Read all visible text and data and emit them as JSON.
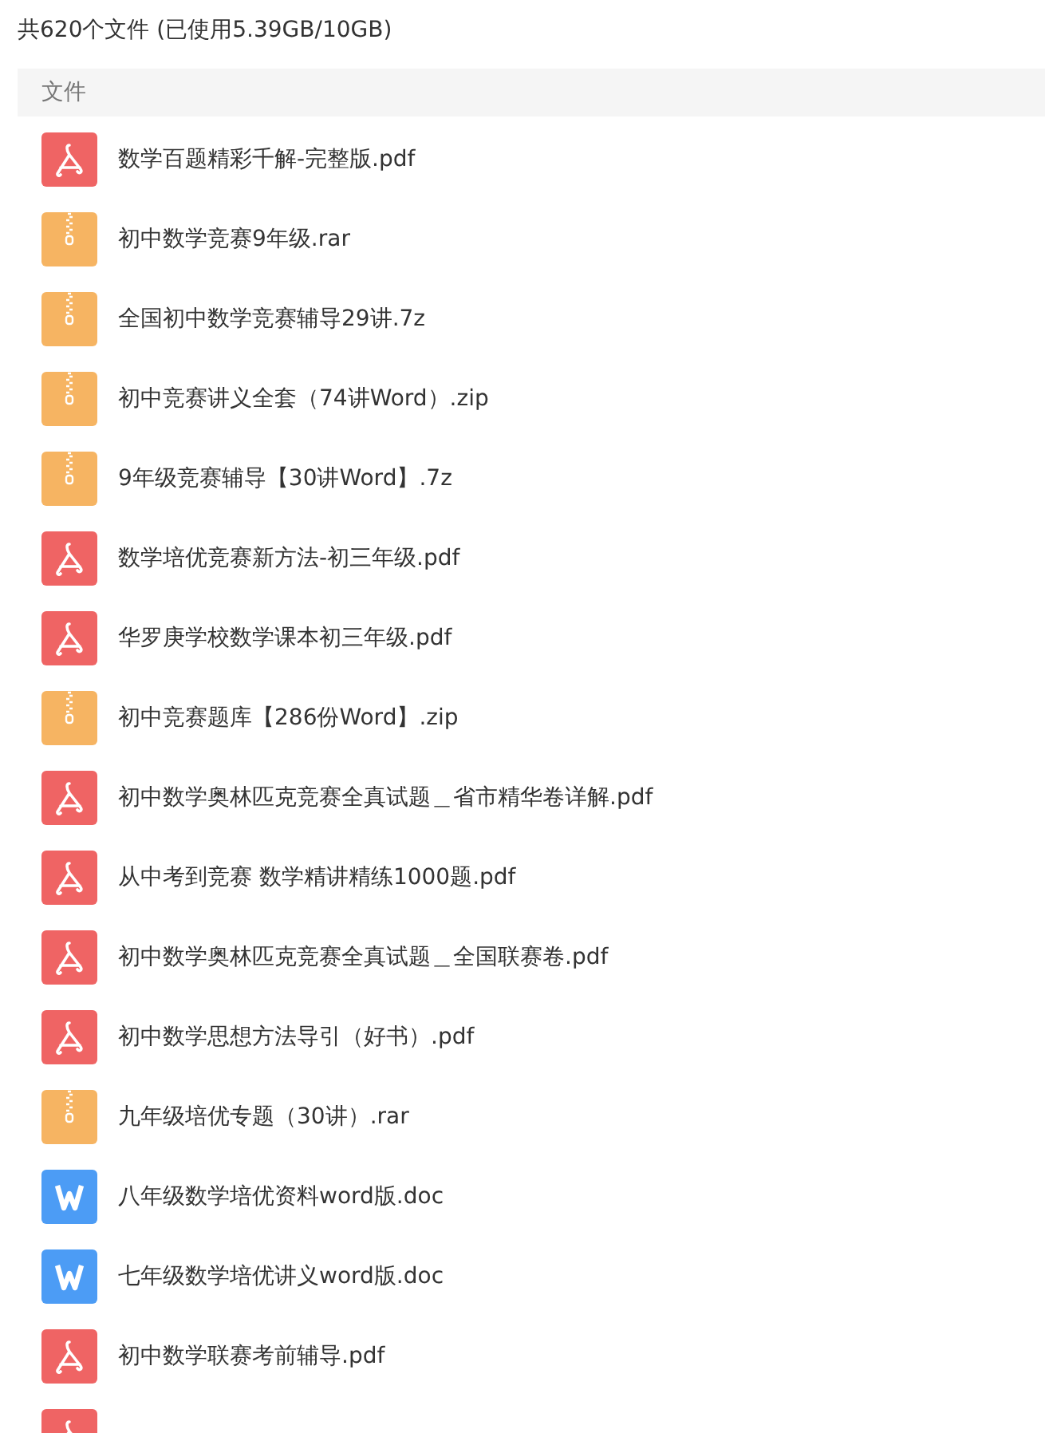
{
  "summary": "共620个文件 (已使用5.39GB/10GB)",
  "table": {
    "column_header": "文件"
  },
  "files": [
    {
      "kind": "pdf",
      "name": "数学百题精彩千解-完整版.pdf"
    },
    {
      "kind": "archive",
      "name": "初中数学竞赛9年级.rar"
    },
    {
      "kind": "archive",
      "name": "全国初中数学竞赛辅导29讲.7z"
    },
    {
      "kind": "archive",
      "name": "初中竞赛讲义全套（74讲Word）.zip"
    },
    {
      "kind": "archive",
      "name": "9年级竞赛辅导【30讲Word】.7z"
    },
    {
      "kind": "pdf",
      "name": "数学培优竞赛新方法-初三年级.pdf"
    },
    {
      "kind": "pdf",
      "name": "华罗庚学校数学课本初三年级.pdf"
    },
    {
      "kind": "archive",
      "name": "初中竞赛题库【286份Word】.zip"
    },
    {
      "kind": "pdf",
      "name": "初中数学奥林匹克竞赛全真试题＿省市精华卷详解.pdf"
    },
    {
      "kind": "pdf",
      "name": "从中考到竞赛  数学精讲精练1000题.pdf"
    },
    {
      "kind": "pdf",
      "name": "初中数学奥林匹克竞赛全真试题＿全国联赛卷.pdf"
    },
    {
      "kind": "pdf",
      "name": "初中数学思想方法导引（好书）.pdf"
    },
    {
      "kind": "archive",
      "name": "九年级培优专题（30讲）.rar"
    },
    {
      "kind": "word",
      "name": "八年级数学培优资料word版.doc"
    },
    {
      "kind": "word",
      "name": "七年级数学培优讲义word版.doc"
    },
    {
      "kind": "pdf",
      "name": "初中数学联赛考前辅导.pdf"
    },
    {
      "kind": "pdf"
    }
  ]
}
